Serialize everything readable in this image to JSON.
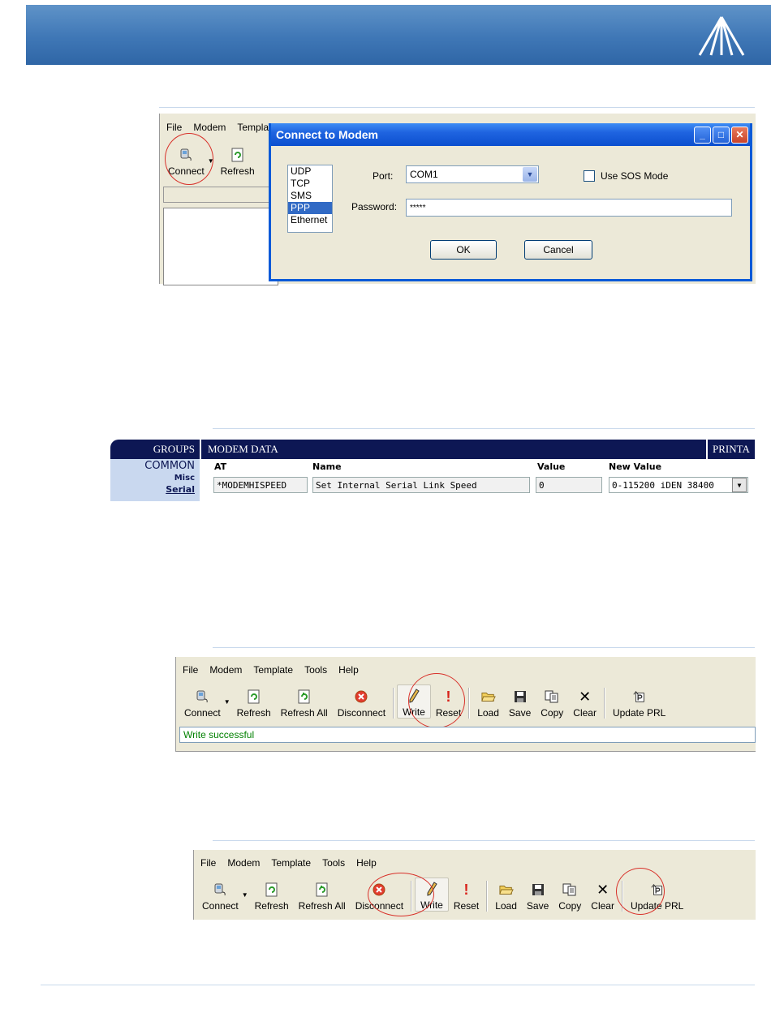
{
  "menu": [
    "File",
    "Modem",
    "Template",
    "Tools",
    "Help"
  ],
  "shot1": {
    "menu_partial": [
      "File",
      "Modem",
      "Templat"
    ],
    "toolbar": {
      "connect": "Connect",
      "refresh": "Refresh"
    }
  },
  "dialog": {
    "title": "Connect to Modem",
    "protocols": [
      "UDP",
      "TCP",
      "SMS",
      "PPP",
      "Ethernet"
    ],
    "selected_protocol": "PPP",
    "port_label": "Port:",
    "port_value": "COM1",
    "sos_label": "Use SOS Mode",
    "password_label": "Password:",
    "password_value": "*****",
    "ok": "OK",
    "cancel": "Cancel"
  },
  "table": {
    "groups_header": "GROUPS",
    "modem_header": "MODEM DATA",
    "printable_header": "PRINTA",
    "group_common": "COMMON",
    "group_misc": "Misc",
    "group_serial": "Serial",
    "col_at": "AT",
    "col_name": "Name",
    "col_value": "Value",
    "col_new_value": "New Value",
    "row": {
      "at": "*MODEMHISPEED",
      "name": "Set Internal Serial Link Speed",
      "value": "0",
      "new_value": "0-115200 iDEN 38400"
    }
  },
  "toolbar": {
    "connect": "Connect",
    "refresh": "Refresh",
    "refresh_all": "Refresh All",
    "disconnect": "Disconnect",
    "write": "Write",
    "reset": "Reset",
    "load": "Load",
    "save": "Save",
    "copy": "Copy",
    "clear": "Clear",
    "update_prl": "Update PRL"
  },
  "status": {
    "message": "Write successful"
  },
  "colors": {
    "status_text": "#008000",
    "highlight_circle": "#d8312a",
    "header_blue": "#3f77b6"
  }
}
